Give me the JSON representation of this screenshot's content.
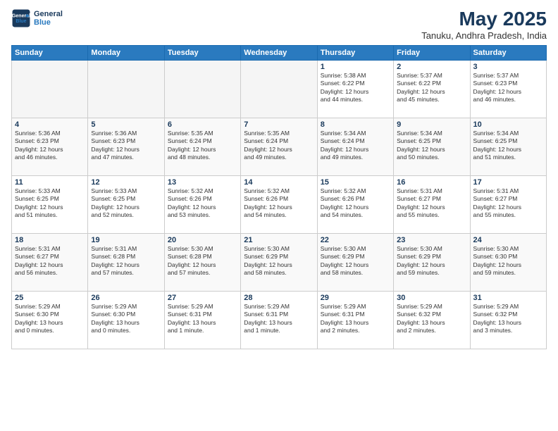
{
  "logo": {
    "line1": "General",
    "line2": "Blue"
  },
  "title": "May 2025",
  "subtitle": "Tanuku, Andhra Pradesh, India",
  "weekdays": [
    "Sunday",
    "Monday",
    "Tuesday",
    "Wednesday",
    "Thursday",
    "Friday",
    "Saturday"
  ],
  "weeks": [
    [
      {
        "day": "",
        "info": ""
      },
      {
        "day": "",
        "info": ""
      },
      {
        "day": "",
        "info": ""
      },
      {
        "day": "",
        "info": ""
      },
      {
        "day": "1",
        "info": "Sunrise: 5:38 AM\nSunset: 6:22 PM\nDaylight: 12 hours\nand 44 minutes."
      },
      {
        "day": "2",
        "info": "Sunrise: 5:37 AM\nSunset: 6:22 PM\nDaylight: 12 hours\nand 45 minutes."
      },
      {
        "day": "3",
        "info": "Sunrise: 5:37 AM\nSunset: 6:23 PM\nDaylight: 12 hours\nand 46 minutes."
      }
    ],
    [
      {
        "day": "4",
        "info": "Sunrise: 5:36 AM\nSunset: 6:23 PM\nDaylight: 12 hours\nand 46 minutes."
      },
      {
        "day": "5",
        "info": "Sunrise: 5:36 AM\nSunset: 6:23 PM\nDaylight: 12 hours\nand 47 minutes."
      },
      {
        "day": "6",
        "info": "Sunrise: 5:35 AM\nSunset: 6:24 PM\nDaylight: 12 hours\nand 48 minutes."
      },
      {
        "day": "7",
        "info": "Sunrise: 5:35 AM\nSunset: 6:24 PM\nDaylight: 12 hours\nand 49 minutes."
      },
      {
        "day": "8",
        "info": "Sunrise: 5:34 AM\nSunset: 6:24 PM\nDaylight: 12 hours\nand 49 minutes."
      },
      {
        "day": "9",
        "info": "Sunrise: 5:34 AM\nSunset: 6:25 PM\nDaylight: 12 hours\nand 50 minutes."
      },
      {
        "day": "10",
        "info": "Sunrise: 5:34 AM\nSunset: 6:25 PM\nDaylight: 12 hours\nand 51 minutes."
      }
    ],
    [
      {
        "day": "11",
        "info": "Sunrise: 5:33 AM\nSunset: 6:25 PM\nDaylight: 12 hours\nand 51 minutes."
      },
      {
        "day": "12",
        "info": "Sunrise: 5:33 AM\nSunset: 6:25 PM\nDaylight: 12 hours\nand 52 minutes."
      },
      {
        "day": "13",
        "info": "Sunrise: 5:32 AM\nSunset: 6:26 PM\nDaylight: 12 hours\nand 53 minutes."
      },
      {
        "day": "14",
        "info": "Sunrise: 5:32 AM\nSunset: 6:26 PM\nDaylight: 12 hours\nand 54 minutes."
      },
      {
        "day": "15",
        "info": "Sunrise: 5:32 AM\nSunset: 6:26 PM\nDaylight: 12 hours\nand 54 minutes."
      },
      {
        "day": "16",
        "info": "Sunrise: 5:31 AM\nSunset: 6:27 PM\nDaylight: 12 hours\nand 55 minutes."
      },
      {
        "day": "17",
        "info": "Sunrise: 5:31 AM\nSunset: 6:27 PM\nDaylight: 12 hours\nand 55 minutes."
      }
    ],
    [
      {
        "day": "18",
        "info": "Sunrise: 5:31 AM\nSunset: 6:27 PM\nDaylight: 12 hours\nand 56 minutes."
      },
      {
        "day": "19",
        "info": "Sunrise: 5:31 AM\nSunset: 6:28 PM\nDaylight: 12 hours\nand 57 minutes."
      },
      {
        "day": "20",
        "info": "Sunrise: 5:30 AM\nSunset: 6:28 PM\nDaylight: 12 hours\nand 57 minutes."
      },
      {
        "day": "21",
        "info": "Sunrise: 5:30 AM\nSunset: 6:29 PM\nDaylight: 12 hours\nand 58 minutes."
      },
      {
        "day": "22",
        "info": "Sunrise: 5:30 AM\nSunset: 6:29 PM\nDaylight: 12 hours\nand 58 minutes."
      },
      {
        "day": "23",
        "info": "Sunrise: 5:30 AM\nSunset: 6:29 PM\nDaylight: 12 hours\nand 59 minutes."
      },
      {
        "day": "24",
        "info": "Sunrise: 5:30 AM\nSunset: 6:30 PM\nDaylight: 12 hours\nand 59 minutes."
      }
    ],
    [
      {
        "day": "25",
        "info": "Sunrise: 5:29 AM\nSunset: 6:30 PM\nDaylight: 13 hours\nand 0 minutes."
      },
      {
        "day": "26",
        "info": "Sunrise: 5:29 AM\nSunset: 6:30 PM\nDaylight: 13 hours\nand 0 minutes."
      },
      {
        "day": "27",
        "info": "Sunrise: 5:29 AM\nSunset: 6:31 PM\nDaylight: 13 hours\nand 1 minute."
      },
      {
        "day": "28",
        "info": "Sunrise: 5:29 AM\nSunset: 6:31 PM\nDaylight: 13 hours\nand 1 minute."
      },
      {
        "day": "29",
        "info": "Sunrise: 5:29 AM\nSunset: 6:31 PM\nDaylight: 13 hours\nand 2 minutes."
      },
      {
        "day": "30",
        "info": "Sunrise: 5:29 AM\nSunset: 6:32 PM\nDaylight: 13 hours\nand 2 minutes."
      },
      {
        "day": "31",
        "info": "Sunrise: 5:29 AM\nSunset: 6:32 PM\nDaylight: 13 hours\nand 3 minutes."
      }
    ]
  ]
}
